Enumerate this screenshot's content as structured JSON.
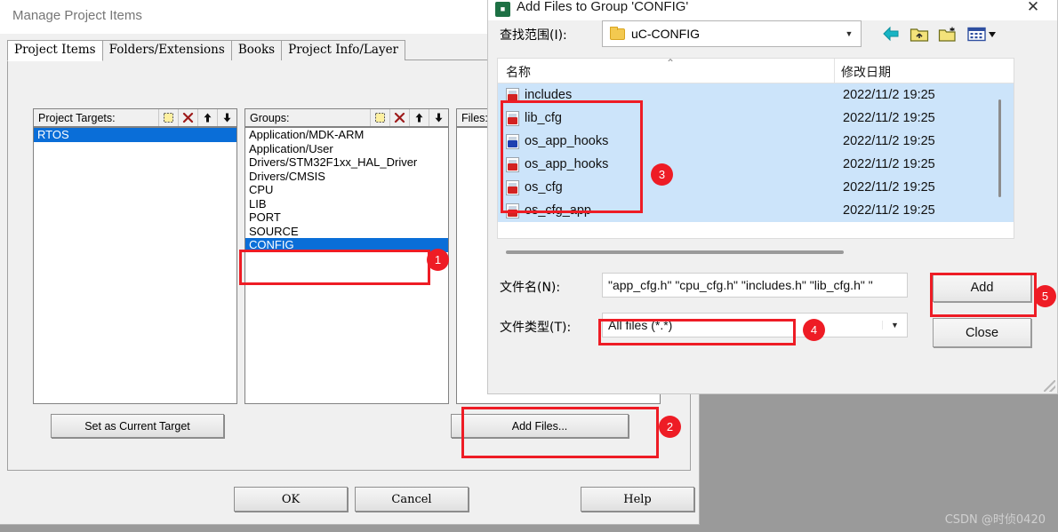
{
  "background_window": {
    "title": "Manage Project Items",
    "tabs": [
      {
        "label": "Project Items",
        "active": true
      },
      {
        "label": "Folders/Extensions",
        "active": false
      },
      {
        "label": "Books",
        "active": false
      },
      {
        "label": "Project Info/Layer",
        "active": false
      }
    ],
    "project_targets": {
      "header": "Project Targets:",
      "items": [
        {
          "label": "RTOS",
          "selected": true
        }
      ]
    },
    "groups": {
      "header": "Groups:",
      "items": [
        {
          "label": "Application/MDK-ARM",
          "selected": false
        },
        {
          "label": "Application/User",
          "selected": false
        },
        {
          "label": "Drivers/STM32F1xx_HAL_Driver",
          "selected": false
        },
        {
          "label": "Drivers/CMSIS",
          "selected": false
        },
        {
          "label": "CPU",
          "selected": false
        },
        {
          "label": "LIB",
          "selected": false
        },
        {
          "label": "PORT",
          "selected": false
        },
        {
          "label": "SOURCE",
          "selected": false
        },
        {
          "label": "CONFIG",
          "selected": true
        }
      ]
    },
    "files": {
      "header": "Files:",
      "items": []
    },
    "set_as_current_target_button": "Set as Current Target",
    "add_files_button": "Add Files...",
    "footer_buttons": {
      "ok": "OK",
      "cancel": "Cancel",
      "help": "Help"
    }
  },
  "add_files_dialog": {
    "title": "Add Files to Group 'CONFIG'",
    "close_glyph": "✕",
    "look_in": {
      "label": "查找范围(I):",
      "value": "uC-CONFIG",
      "arrow": "▼"
    },
    "nav_icons": [
      {
        "name": "back-icon"
      },
      {
        "name": "up-folder-icon"
      },
      {
        "name": "new-folder-icon"
      },
      {
        "name": "view-mode-icon"
      }
    ],
    "file_list": {
      "columns": [
        "名称",
        "修改日期"
      ],
      "sort_caret": "⌃",
      "rows": [
        {
          "name": "includes",
          "icon": "h-file-icon",
          "date": "2022/11/2 19:25",
          "selected": true
        },
        {
          "name": "lib_cfg",
          "icon": "h-file-icon",
          "date": "2022/11/2 19:25",
          "selected": true
        },
        {
          "name": "os_app_hooks",
          "icon": "c-file-icon",
          "date": "2022/11/2 19:25",
          "selected": true
        },
        {
          "name": "os_app_hooks",
          "icon": "h-file-icon",
          "date": "2022/11/2 19:25",
          "selected": true
        },
        {
          "name": "os_cfg",
          "icon": "h-file-icon",
          "date": "2022/11/2 19:25",
          "selected": true
        },
        {
          "name": "os_cfg_app",
          "icon": "h-file-icon",
          "date": "2022/11/2 19:25",
          "selected": true
        }
      ]
    },
    "file_name": {
      "label": "文件名(N):",
      "value": "\"app_cfg.h\" \"cpu_cfg.h\" \"includes.h\" \"lib_cfg.h\" \""
    },
    "file_type": {
      "label": "文件类型(T):",
      "value": "All files (*.*)",
      "arrow": "▼"
    },
    "add_button": "Add",
    "close_button": "Close"
  },
  "annotations": {
    "markers": [
      {
        "number": "1",
        "target": "groups-config-item"
      },
      {
        "number": "2",
        "target": "add-files-button"
      },
      {
        "number": "3",
        "target": "file-list-selection"
      },
      {
        "number": "4",
        "target": "file-type-combo"
      },
      {
        "number": "5",
        "target": "add-button"
      }
    ],
    "color": "#ee1c25"
  },
  "watermark": "CSDN @时侦0420",
  "colors": {
    "selection_blue": "#0a6ed8",
    "list_selection_light": "#cce4fa",
    "annotation_red": "#ee1c25",
    "window_face": "#f0f0f0",
    "desktop": "#9a9a9a"
  }
}
